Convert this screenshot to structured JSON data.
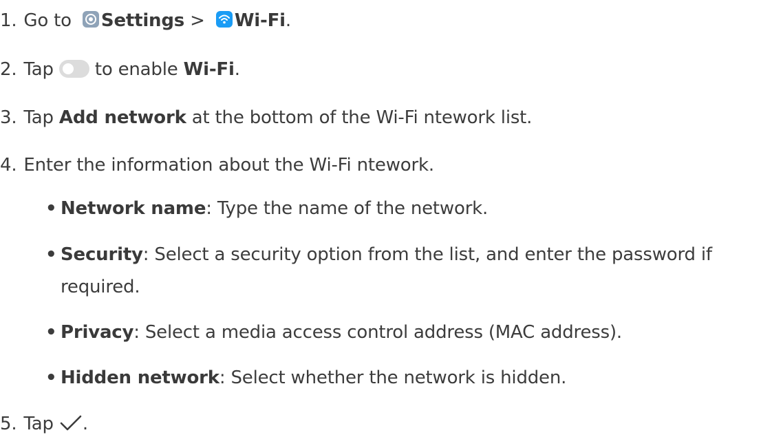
{
  "steps": [
    {
      "num": "1.",
      "pre": "Go to",
      "settings": "Settings",
      "sep": ">",
      "wifi": "Wi-Fi",
      "end": "."
    },
    {
      "num": "2.",
      "pre": "Tap",
      "mid": "to enable",
      "bold": "Wi-Fi",
      "end": "."
    },
    {
      "num": "3.",
      "pre": "Tap",
      "bold": "Add network",
      "rest": "at the bottom of the Wi-Fi ntework list."
    },
    {
      "num": "4.",
      "text": "Enter the information about the Wi-Fi ntework."
    },
    {
      "num": "5.",
      "pre": "Tap",
      "end": "."
    }
  ],
  "bullets": [
    {
      "symbol": "•",
      "term": "Network name",
      "desc": ": Type the name of the network."
    },
    {
      "symbol": "•",
      "term": "Security",
      "desc": ": Select a security option from the list, and enter the password if",
      "cont": "required."
    },
    {
      "symbol": "•",
      "term": "Privacy",
      "desc": ": Select a media access control address (MAC address)."
    },
    {
      "symbol": "•",
      "term": "Hidden network",
      "desc": ": Select whether the network is hidden."
    }
  ],
  "icons": {
    "settings": "settings-gear-icon",
    "wifi": "wifi-icon",
    "toggle": "toggle-switch-icon",
    "confirm": "checkmark-icon"
  },
  "colors": {
    "text": "#3c3c3c",
    "settings_icon": "#8fa3b8",
    "wifi_icon": "#1a9cf5",
    "toggle_off": "#dcdcdc"
  }
}
